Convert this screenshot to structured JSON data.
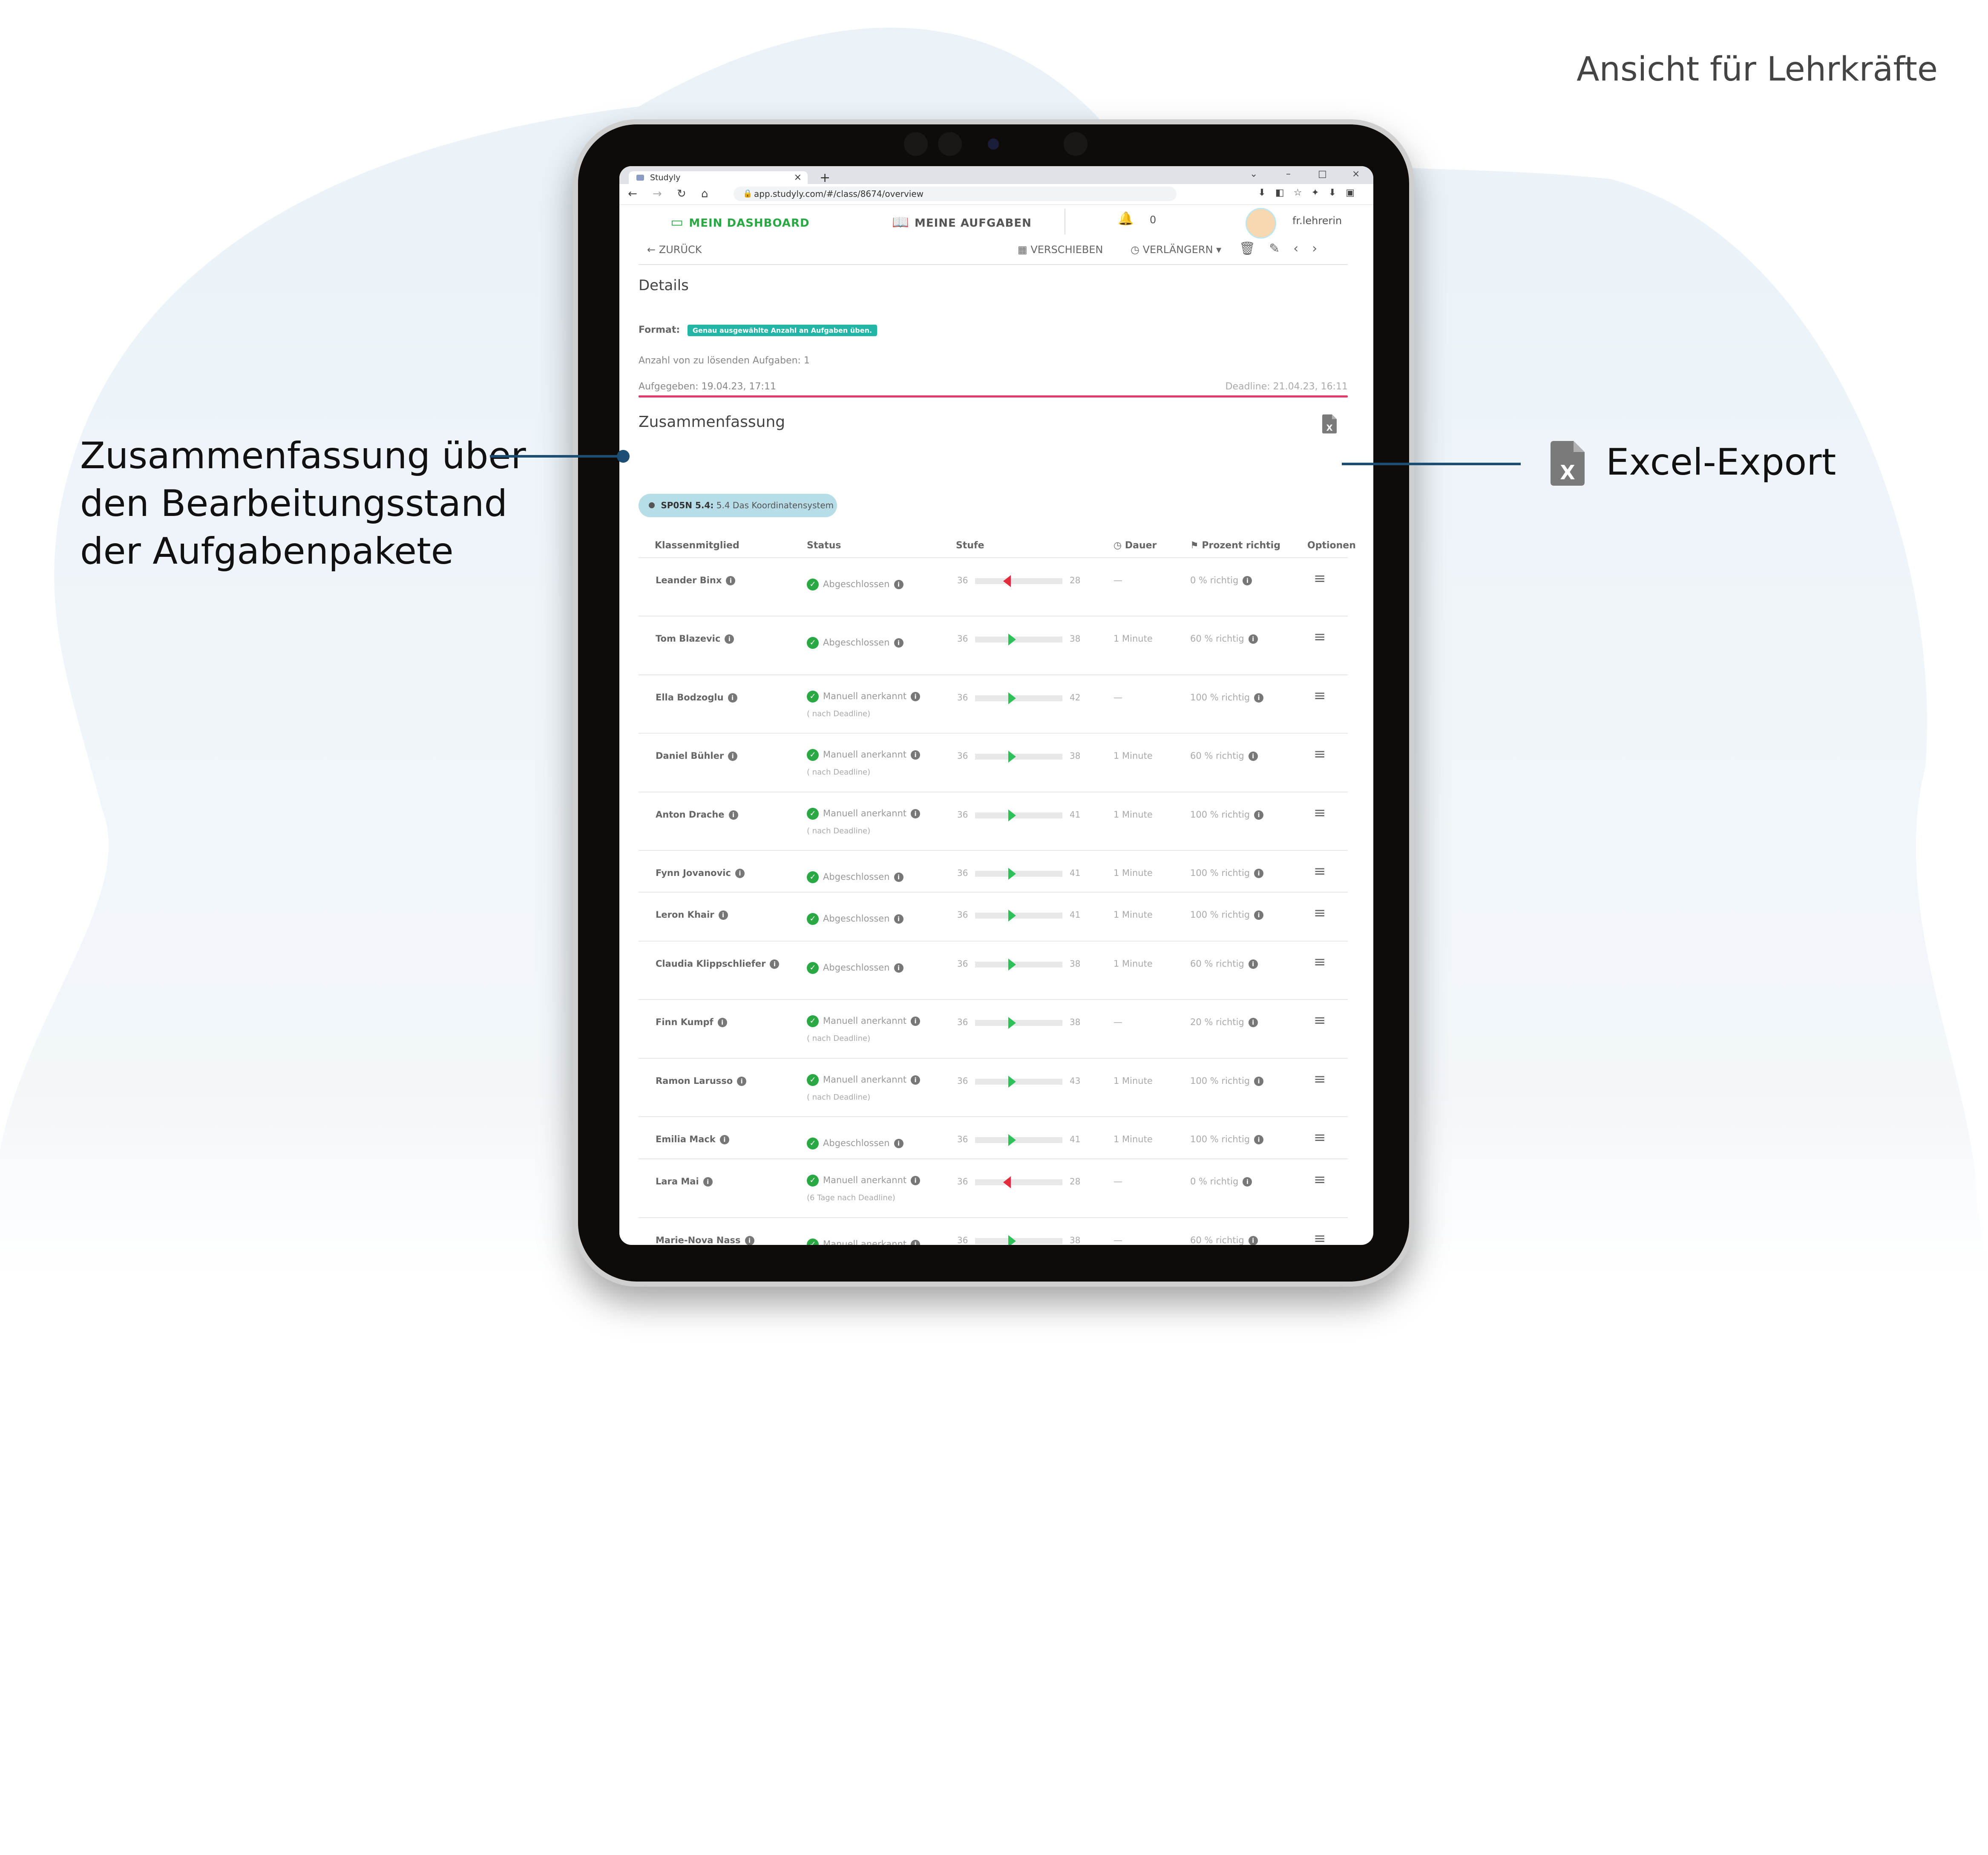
{
  "view_label": "Ansicht für Lehrkräfte",
  "callouts": {
    "summary": [
      "Zusammenfassung über",
      "den Bearbeitungsstand",
      "der Aufgabenpakete"
    ],
    "excel": "Excel-Export"
  },
  "browser": {
    "tab_title": "Studyly",
    "url": "app.studyly.com/#/class/8674/overview"
  },
  "app": {
    "nav_dashboard": "MEIN DASHBOARD",
    "nav_tasks": "MEINE AUFGABEN",
    "notifications": "0",
    "user": "fr.lehrerin"
  },
  "toolbar": {
    "back": "ZURÜCK",
    "move": "VERSCHIEBEN",
    "extend": "VERLÄNGERN"
  },
  "details": {
    "title": "Details",
    "format_label": "Format:",
    "format_value": "Genau ausgewählte Anzahl an Aufgaben üben.",
    "count_text": "Anzahl von zu lösenden Aufgaben: 1",
    "assigned": "Aufgegeben: 19.04.23, 17:11",
    "deadline": "Deadline: 21.04.23, 16:11"
  },
  "summary": {
    "title": "Zusammenfassung",
    "package_code": "SP05N 5.4:",
    "package_name": "5.4 Das Koordinatensystem"
  },
  "table": {
    "headers": {
      "member": "Klassenmitglied",
      "status": "Status",
      "level": "Stufe",
      "duration": "Dauer",
      "percent": "Prozent richtig",
      "options": "Optionen"
    },
    "rows": [
      {
        "name": "Leander Binx",
        "status": "Abgeschlossen",
        "sub": "",
        "from": "36",
        "to": "28",
        "progress": 0.32,
        "dir": "down",
        "duration": "—",
        "percent": "0 % richtig"
      },
      {
        "name": "Tom Blazevic",
        "status": "Abgeschlossen",
        "sub": "",
        "from": "36",
        "to": "38",
        "progress": 0.38,
        "dir": "up",
        "duration": "1 Minute",
        "percent": "60 % richtig"
      },
      {
        "name": "Ella Bodzoglu",
        "status": "Manuell anerkannt",
        "sub": "( nach Deadline)",
        "from": "36",
        "to": "42",
        "progress": 0.38,
        "dir": "up",
        "duration": "—",
        "percent": "100 % richtig"
      },
      {
        "name": "Daniel Bühler",
        "status": "Manuell anerkannt",
        "sub": "( nach Deadline)",
        "from": "36",
        "to": "38",
        "progress": 0.38,
        "dir": "up",
        "duration": "1 Minute",
        "percent": "60 % richtig"
      },
      {
        "name": "Anton Drache",
        "status": "Manuell anerkannt",
        "sub": "( nach Deadline)",
        "from": "36",
        "to": "41",
        "progress": 0.38,
        "dir": "up",
        "duration": "1 Minute",
        "percent": "100 % richtig"
      },
      {
        "name": "Fynn Jovanovic",
        "status": "Abgeschlossen",
        "sub": "",
        "from": "36",
        "to": "41",
        "progress": 0.38,
        "dir": "up",
        "duration": "1 Minute",
        "percent": "100 % richtig"
      },
      {
        "name": "Leron Khair",
        "status": "Abgeschlossen",
        "sub": "",
        "from": "36",
        "to": "41",
        "progress": 0.38,
        "dir": "up",
        "duration": "1 Minute",
        "percent": "100 % richtig"
      },
      {
        "name": "Claudia Klippschliefer",
        "status": "Abgeschlossen",
        "sub": "",
        "from": "36",
        "to": "38",
        "progress": 0.38,
        "dir": "up",
        "duration": "1 Minute",
        "percent": "60 % richtig"
      },
      {
        "name": "Finn Kumpf",
        "status": "Manuell anerkannt",
        "sub": "( nach Deadline)",
        "from": "36",
        "to": "38",
        "progress": 0.38,
        "dir": "up",
        "duration": "—",
        "percent": "20 % richtig"
      },
      {
        "name": "Ramon Larusso",
        "status": "Manuell anerkannt",
        "sub": "( nach Deadline)",
        "from": "36",
        "to": "43",
        "progress": 0.38,
        "dir": "up",
        "duration": "1 Minute",
        "percent": "100 % richtig"
      },
      {
        "name": "Emilia Mack",
        "status": "Abgeschlossen",
        "sub": "",
        "from": "36",
        "to": "41",
        "progress": 0.38,
        "dir": "up",
        "duration": "1 Minute",
        "percent": "100 % richtig"
      },
      {
        "name": "Lara Mai",
        "status": "Manuell anerkannt",
        "sub": "(6 Tage nach Deadline)",
        "from": "36",
        "to": "28",
        "progress": 0.32,
        "dir": "down",
        "duration": "—",
        "percent": "0 % richtig"
      },
      {
        "name": "Marie-Nova Nass",
        "status": "Manuell anerkannt",
        "sub": "",
        "from": "36",
        "to": "38",
        "progress": 0.38,
        "dir": "up",
        "duration": "—",
        "percent": "60 % richtig"
      }
    ]
  },
  "colors": {
    "accent_green": "#2aa844",
    "deadline_line": "#e03a6a",
    "callout_line": "#1c4e73",
    "format_badge": "#23b5a6"
  }
}
